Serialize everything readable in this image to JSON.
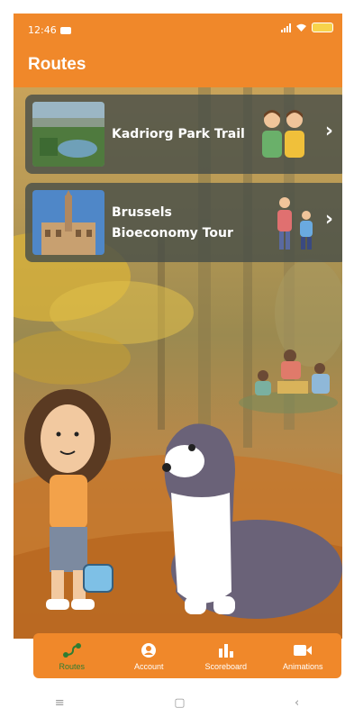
{
  "status": {
    "time": "12:46",
    "battery_level": ""
  },
  "header": {
    "title": "Routes"
  },
  "routes": [
    {
      "title": "Kadriorg Park Trail",
      "thumb_icon": "park-image",
      "group_icon": "two-kids-icon"
    },
    {
      "title": "Brussels Bioeconomy Tour",
      "thumb_icon": "city-hall-image",
      "group_icon": "family-icon"
    }
  ],
  "tabs": [
    {
      "label": "Routes",
      "icon": "route-icon",
      "active": true
    },
    {
      "label": "Account",
      "icon": "account-icon",
      "active": false
    },
    {
      "label": "Scoreboard",
      "icon": "scoreboard-icon",
      "active": false
    },
    {
      "label": "Animations",
      "icon": "animations-icon",
      "active": false
    }
  ],
  "colors": {
    "brand": "#f0882a",
    "active_tab": "#2e7d32",
    "card": "#464e48"
  }
}
